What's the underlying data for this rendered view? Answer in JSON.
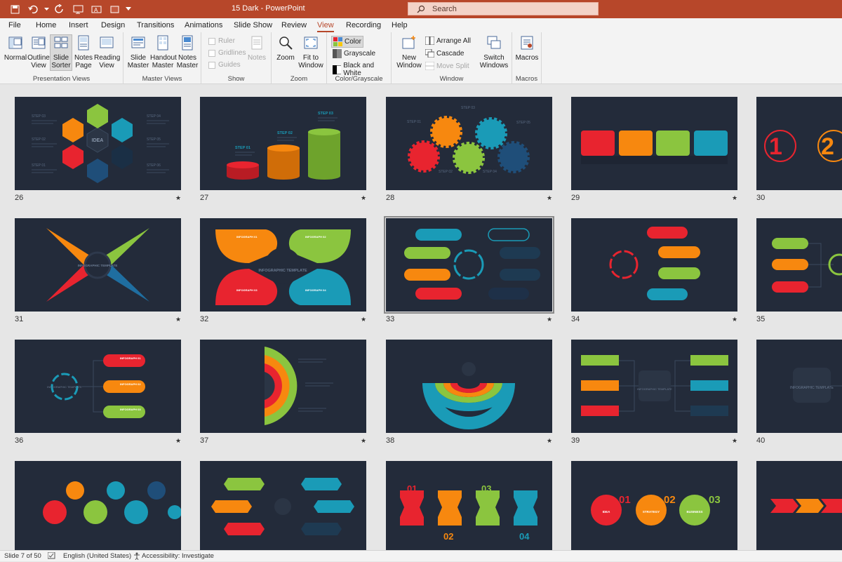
{
  "titlebar": {
    "title": "15 Dark  -  PowerPoint",
    "search_placeholder": "Search"
  },
  "menu": [
    "File",
    "Home",
    "Insert",
    "Design",
    "Transitions",
    "Animations",
    "Slide Show",
    "Review",
    "View",
    "Recording",
    "Help"
  ],
  "active_tab": "View",
  "ribbon": {
    "presentation_views": {
      "label": "Presentation Views",
      "buttons": [
        "Normal",
        "Outline\nView",
        "Slide\nSorter",
        "Notes\nPage",
        "Reading\nView"
      ]
    },
    "master_views": {
      "label": "Master Views",
      "buttons": [
        "Slide\nMaster",
        "Handout\nMaster",
        "Notes\nMaster"
      ]
    },
    "show": {
      "label": "Show",
      "checks": [
        "Ruler",
        "Gridlines",
        "Guides"
      ],
      "notes": "Notes"
    },
    "zoom": {
      "label": "Zoom",
      "buttons": [
        "Zoom",
        "Fit to\nWindow"
      ]
    },
    "color": {
      "label": "Color/Grayscale",
      "items": [
        "Color",
        "Grayscale",
        "Black and White"
      ]
    },
    "window": {
      "label": "Window",
      "new_window": "New\nWindow",
      "arrange_all": "Arrange All",
      "cascade": "Cascade",
      "move_split": "Move Split",
      "switch": "Switch\nWindows"
    },
    "macros": {
      "label": "Macros",
      "button": "Macros"
    }
  },
  "slides": [
    {
      "n": "26",
      "star": true
    },
    {
      "n": "27",
      "star": true
    },
    {
      "n": "28",
      "star": true
    },
    {
      "n": "29",
      "star": true
    },
    {
      "n": "30",
      "star": false
    },
    {
      "n": "31",
      "star": true
    },
    {
      "n": "32",
      "star": true
    },
    {
      "n": "33",
      "star": true
    },
    {
      "n": "34",
      "star": true
    },
    {
      "n": "35",
      "star": false
    },
    {
      "n": "36",
      "star": true
    },
    {
      "n": "37",
      "star": true
    },
    {
      "n": "38",
      "star": true
    },
    {
      "n": "39",
      "star": true
    },
    {
      "n": "40",
      "star": false
    },
    {
      "n": "",
      "star": false
    },
    {
      "n": "",
      "star": false
    },
    {
      "n": "",
      "star": false
    },
    {
      "n": "",
      "star": false
    },
    {
      "n": "",
      "star": false
    }
  ],
  "slide_text": {
    "s26": {
      "center": "IDEA",
      "steps": [
        "STEP 03",
        "STEP 02",
        "STEP 01",
        "STEP 04",
        "STEP 05",
        "STEP 06"
      ]
    },
    "s27": {
      "steps": [
        "STEP 01",
        "STEP 02",
        "STEP 03"
      ]
    },
    "s28": {
      "steps": [
        "STEP 01",
        "STEP 03",
        "STEP 05",
        "STEP 02",
        "STEP 04"
      ]
    },
    "s30": {
      "nums": [
        "1",
        "2"
      ]
    },
    "s31": {
      "center": "INFOGRAPHIC TEMPLATE"
    },
    "s32": {
      "center": "INFOGRAPHIC TEMPLATE",
      "labels": [
        "INFOGRAPH 01",
        "INFOGRAPH 02",
        "INFOGRAPH 03",
        "INFOGRAPH 04"
      ]
    },
    "s36": {
      "center": "INFOGRAPHIC TEMPLATE",
      "labels": [
        "INFOGRAPH 01",
        "INFOGRAPH 02",
        "INFOGRAPH 03"
      ]
    },
    "s39": {
      "center": "INFOGRAPHIC TEMPLATE"
    },
    "s40": {
      "center": "INFOGRAPHIC TEMPLATE"
    },
    "s43": {
      "nums": [
        "01",
        "02",
        "03",
        "04"
      ]
    },
    "s44": {
      "nums": [
        "01",
        "02",
        "03"
      ],
      "labels": [
        "IDEA",
        "STRATEGY",
        "BUSINESS"
      ]
    }
  },
  "status": {
    "slide": "Slide 7 of 50",
    "language": "English (United States)",
    "accessibility": "Accessibility: Investigate"
  },
  "colors": {
    "accent": "#b7472a",
    "slide_bg": "#232b3a",
    "red": "#e8242f",
    "orange": "#f7880f",
    "green": "#8bc53f",
    "teal": "#1a9bb7",
    "navy": "#1f4e79"
  }
}
